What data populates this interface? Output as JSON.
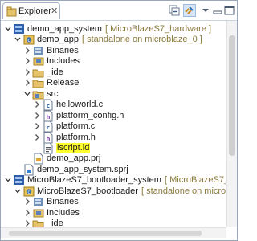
{
  "view": {
    "tab_label": "Explorer",
    "close_glyph": "✕",
    "toolbar": [
      "collapse-all-icon",
      "link-with-editor-icon",
      "view-menu-icon",
      "minimize-icon",
      "maximize-icon"
    ]
  },
  "tree": [
    {
      "label": "demo_app_system",
      "suffix": "[ MicroBlazeS7_hardware ]",
      "icon": "system-project-icon",
      "state": "open"
    },
    {
      "label": "demo_app",
      "suffix": "[ standalone on microblaze_0 ]",
      "icon": "app-project-icon",
      "state": "open"
    },
    {
      "label": "Binaries",
      "icon": "binaries-icon",
      "state": "closed"
    },
    {
      "label": "Includes",
      "icon": "includes-icon",
      "state": "closed"
    },
    {
      "label": "_ide",
      "icon": "folder-icon",
      "state": "closed"
    },
    {
      "label": "Release",
      "icon": "folder-icon",
      "state": "closed"
    },
    {
      "label": "src",
      "icon": "src-folder-icon",
      "state": "open"
    },
    {
      "label": "helloworld.c",
      "icon": "c-file-icon",
      "state": "closed"
    },
    {
      "label": "platform_config.h",
      "icon": "h-file-icon",
      "state": "closed"
    },
    {
      "label": "platform.c",
      "icon": "c-file-icon",
      "state": "closed"
    },
    {
      "label": "platform.h",
      "icon": "h-file-icon",
      "state": "closed"
    },
    {
      "label": "lscript.ld",
      "icon": "linker-script-icon",
      "state": "leaf",
      "highlight": true
    },
    {
      "label": "demo_app.prj",
      "icon": "prj-file-icon",
      "state": "leaf"
    },
    {
      "label": "demo_app_system.sprj",
      "icon": "sprj-file-icon",
      "state": "leaf"
    },
    {
      "label": "MicroBlazeS7_bootloader_system",
      "suffix": "[ MicroBlazeS7_hardware ]",
      "icon": "system-project-icon",
      "state": "open"
    },
    {
      "label": "MicroBlazeS7_bootloader",
      "suffix": "[ standalone on microblaze_0 ]",
      "icon": "app-project-icon",
      "state": "open"
    },
    {
      "label": "Binaries",
      "icon": "binaries-icon",
      "state": "closed"
    },
    {
      "label": "Includes",
      "icon": "includes-icon",
      "state": "closed"
    },
    {
      "label": "_ide",
      "icon": "folder-icon",
      "state": "closed"
    }
  ]
}
